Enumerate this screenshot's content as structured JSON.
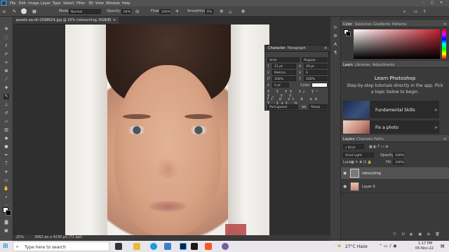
{
  "menu": [
    "File",
    "Edit",
    "Image",
    "Layer",
    "Type",
    "Select",
    "Filter",
    "3D",
    "View",
    "Window",
    "Help"
  ],
  "options": {
    "mode_label": "Mode:",
    "mode_value": "Normal",
    "opacity_label": "Opacity:",
    "opacity_value": "64%",
    "flow_label": "Flow:",
    "flow_value": "100%",
    "smoothing_label": "Smoothing:",
    "smoothing_value": "0%"
  },
  "document": {
    "tab": "pexels-aa-dil-2598024.jpg @ 25% (retouching, RGB/8)"
  },
  "status": {
    "zoom": "25%",
    "info": "3962 px x 4230 px (72 ppi)"
  },
  "character": {
    "tabs": [
      "Character",
      "Paragraph"
    ],
    "font": "Arial",
    "style": "Regular",
    "size": "21 pt",
    "leading": "29 pt",
    "tracking": "Metrics",
    "kerning": "0",
    "vscale": "100%",
    "hscale": "100%",
    "baseline": "0 pt",
    "color_label": "Color:",
    "language": "Portuguese",
    "aa_label": "aa",
    "aa_value": "Sharp"
  },
  "color_panel": {
    "tabs": [
      "Color",
      "Swatches",
      "Gradients",
      "Patterns"
    ],
    "base_color": "#c4222f"
  },
  "learn": {
    "tabs": [
      "Learn",
      "Libraries",
      "Adjustments"
    ],
    "title": "Learn Photoshop",
    "desc": "Step-by-step tutorials directly in the app. Pick a topic below to begin.",
    "cards": [
      {
        "label": "Fundamental Skills",
        "chevron": ">"
      },
      {
        "label": "Fix a photo",
        "chevron": ">"
      }
    ]
  },
  "layers": {
    "tabs": [
      "Layers",
      "Channels",
      "Paths"
    ],
    "kind": "Kind",
    "blend": "Vivid Light",
    "opacity_label": "Opacity:",
    "opacity_value": "100%",
    "lock_label": "Lock:",
    "fill_label": "Fill:",
    "fill_value": "100%",
    "items": [
      {
        "name": "retouching"
      },
      {
        "name": "Layer 0"
      }
    ]
  },
  "taskbar": {
    "search": "Type here to search",
    "weather": "27°C  Haze",
    "time": "1:17 PM",
    "date": "05-Nov-22"
  }
}
